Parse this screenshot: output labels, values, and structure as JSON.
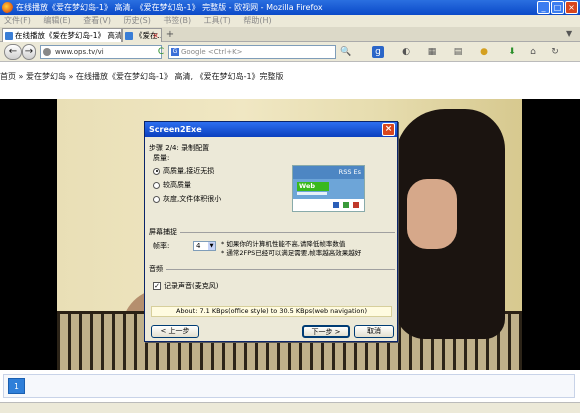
{
  "window": {
    "title": "在线播放《爱在梦幻岛-1》 高清, 《爱在梦幻岛-1》 完整版 - 欧视网 - Mozilla Firefox",
    "minimize": "_",
    "maximize": "□",
    "close": "×"
  },
  "menu": [
    "文件(F)",
    "编辑(E)",
    "查看(V)",
    "历史(S)",
    "书签(B)",
    "工具(T)",
    "帮助(H)"
  ],
  "tabs": [
    {
      "label": "在线播放《爱在梦幻岛-1》 高清, 《爱在梦幻...",
      "active": true
    },
    {
      "label": "《爱在...",
      "active": false
    }
  ],
  "nav": {
    "back": "←",
    "forward": "→",
    "url": "www.ops.tv/vi",
    "search_engine": "G",
    "search_placeholder": "Google <Ctrl+K>",
    "reload": "C",
    "home": "⌂",
    "refresh": "↻"
  },
  "breadcrumb": [
    "首页",
    "爱在梦幻岛",
    "在线播放《爱在梦幻岛-1》 高清, 《爱在梦幻岛-1》完整版"
  ],
  "dialog": {
    "title": "Screen2Exe",
    "close": "×",
    "step_label": "步骤 2/4: 录制配置",
    "quality_label": "质量:",
    "quality_options": [
      {
        "label": "高质量,接近无损",
        "selected": true
      },
      {
        "label": "较高质量",
        "selected": false
      },
      {
        "label": "灰度,文件体积很小",
        "selected": false
      }
    ],
    "preview": {
      "top_text": "RSS  Es",
      "web_text": "Web"
    },
    "capture_label": "屏幕捕捉",
    "fps_label": "帧率:",
    "fps_value": "4",
    "fps_hint_1": "* 如果你的计算机性能不高,请降低帧率数值",
    "fps_hint_2": "* 通常2FPS已经可以满足需要,帧率越高效果越好",
    "audio_label": "音频",
    "record_audio_label": "记录声音(麦克风)",
    "record_audio_checked": true,
    "about_text": "About: 7.1 KBps(office style) to 30.5 KBps(web navigation)",
    "back_button": "< 上一步",
    "next_button": "下一步 >",
    "cancel_button": "取消"
  },
  "pagination": {
    "current": "1"
  },
  "colors": {
    "accent": "#2f7fd9",
    "title_bar": "#0b49c8",
    "dialog_bg": "#ece9d8"
  }
}
